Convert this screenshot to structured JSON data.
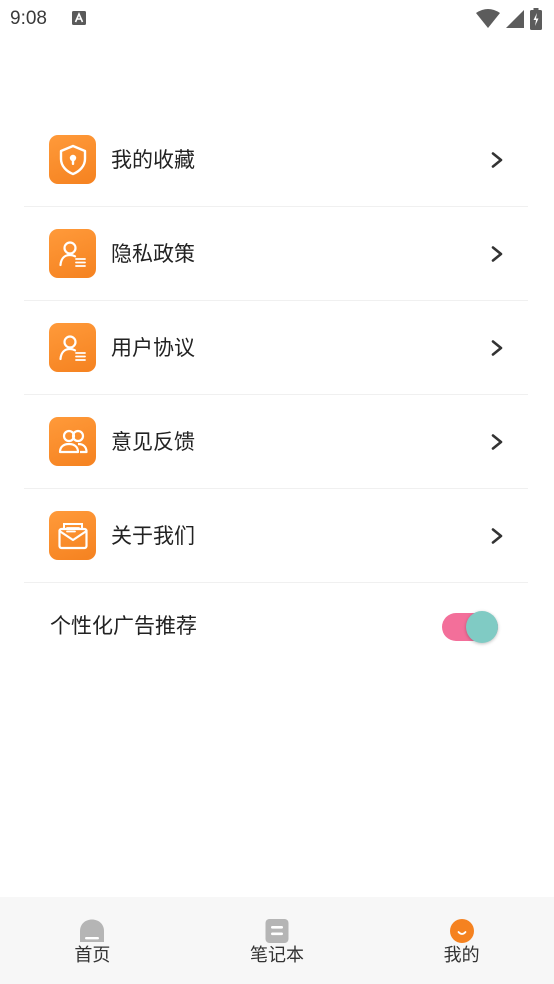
{
  "status_bar": {
    "time": "9:08"
  },
  "menu": {
    "items": [
      {
        "label": "我的收藏",
        "icon": "shield-lock-icon"
      },
      {
        "label": "隐私政策",
        "icon": "user-doc-icon"
      },
      {
        "label": "用户协议",
        "icon": "user-doc-icon"
      },
      {
        "label": "意见反馈",
        "icon": "users-icon"
      },
      {
        "label": "关于我们",
        "icon": "mail-icon"
      }
    ]
  },
  "ad_setting": {
    "label": "个性化广告推荐",
    "enabled": true
  },
  "bottom_nav": {
    "items": [
      {
        "label": "首页",
        "icon": "home-icon",
        "active": false
      },
      {
        "label": "笔记本",
        "icon": "notebook-icon",
        "active": false
      },
      {
        "label": "我的",
        "icon": "profile-icon",
        "active": true
      }
    ]
  },
  "colors": {
    "accent": "#f58220",
    "toggle_track": "#f36f9a",
    "toggle_knob": "#80cbc4",
    "nav_inactive": "#b5b5b5"
  }
}
